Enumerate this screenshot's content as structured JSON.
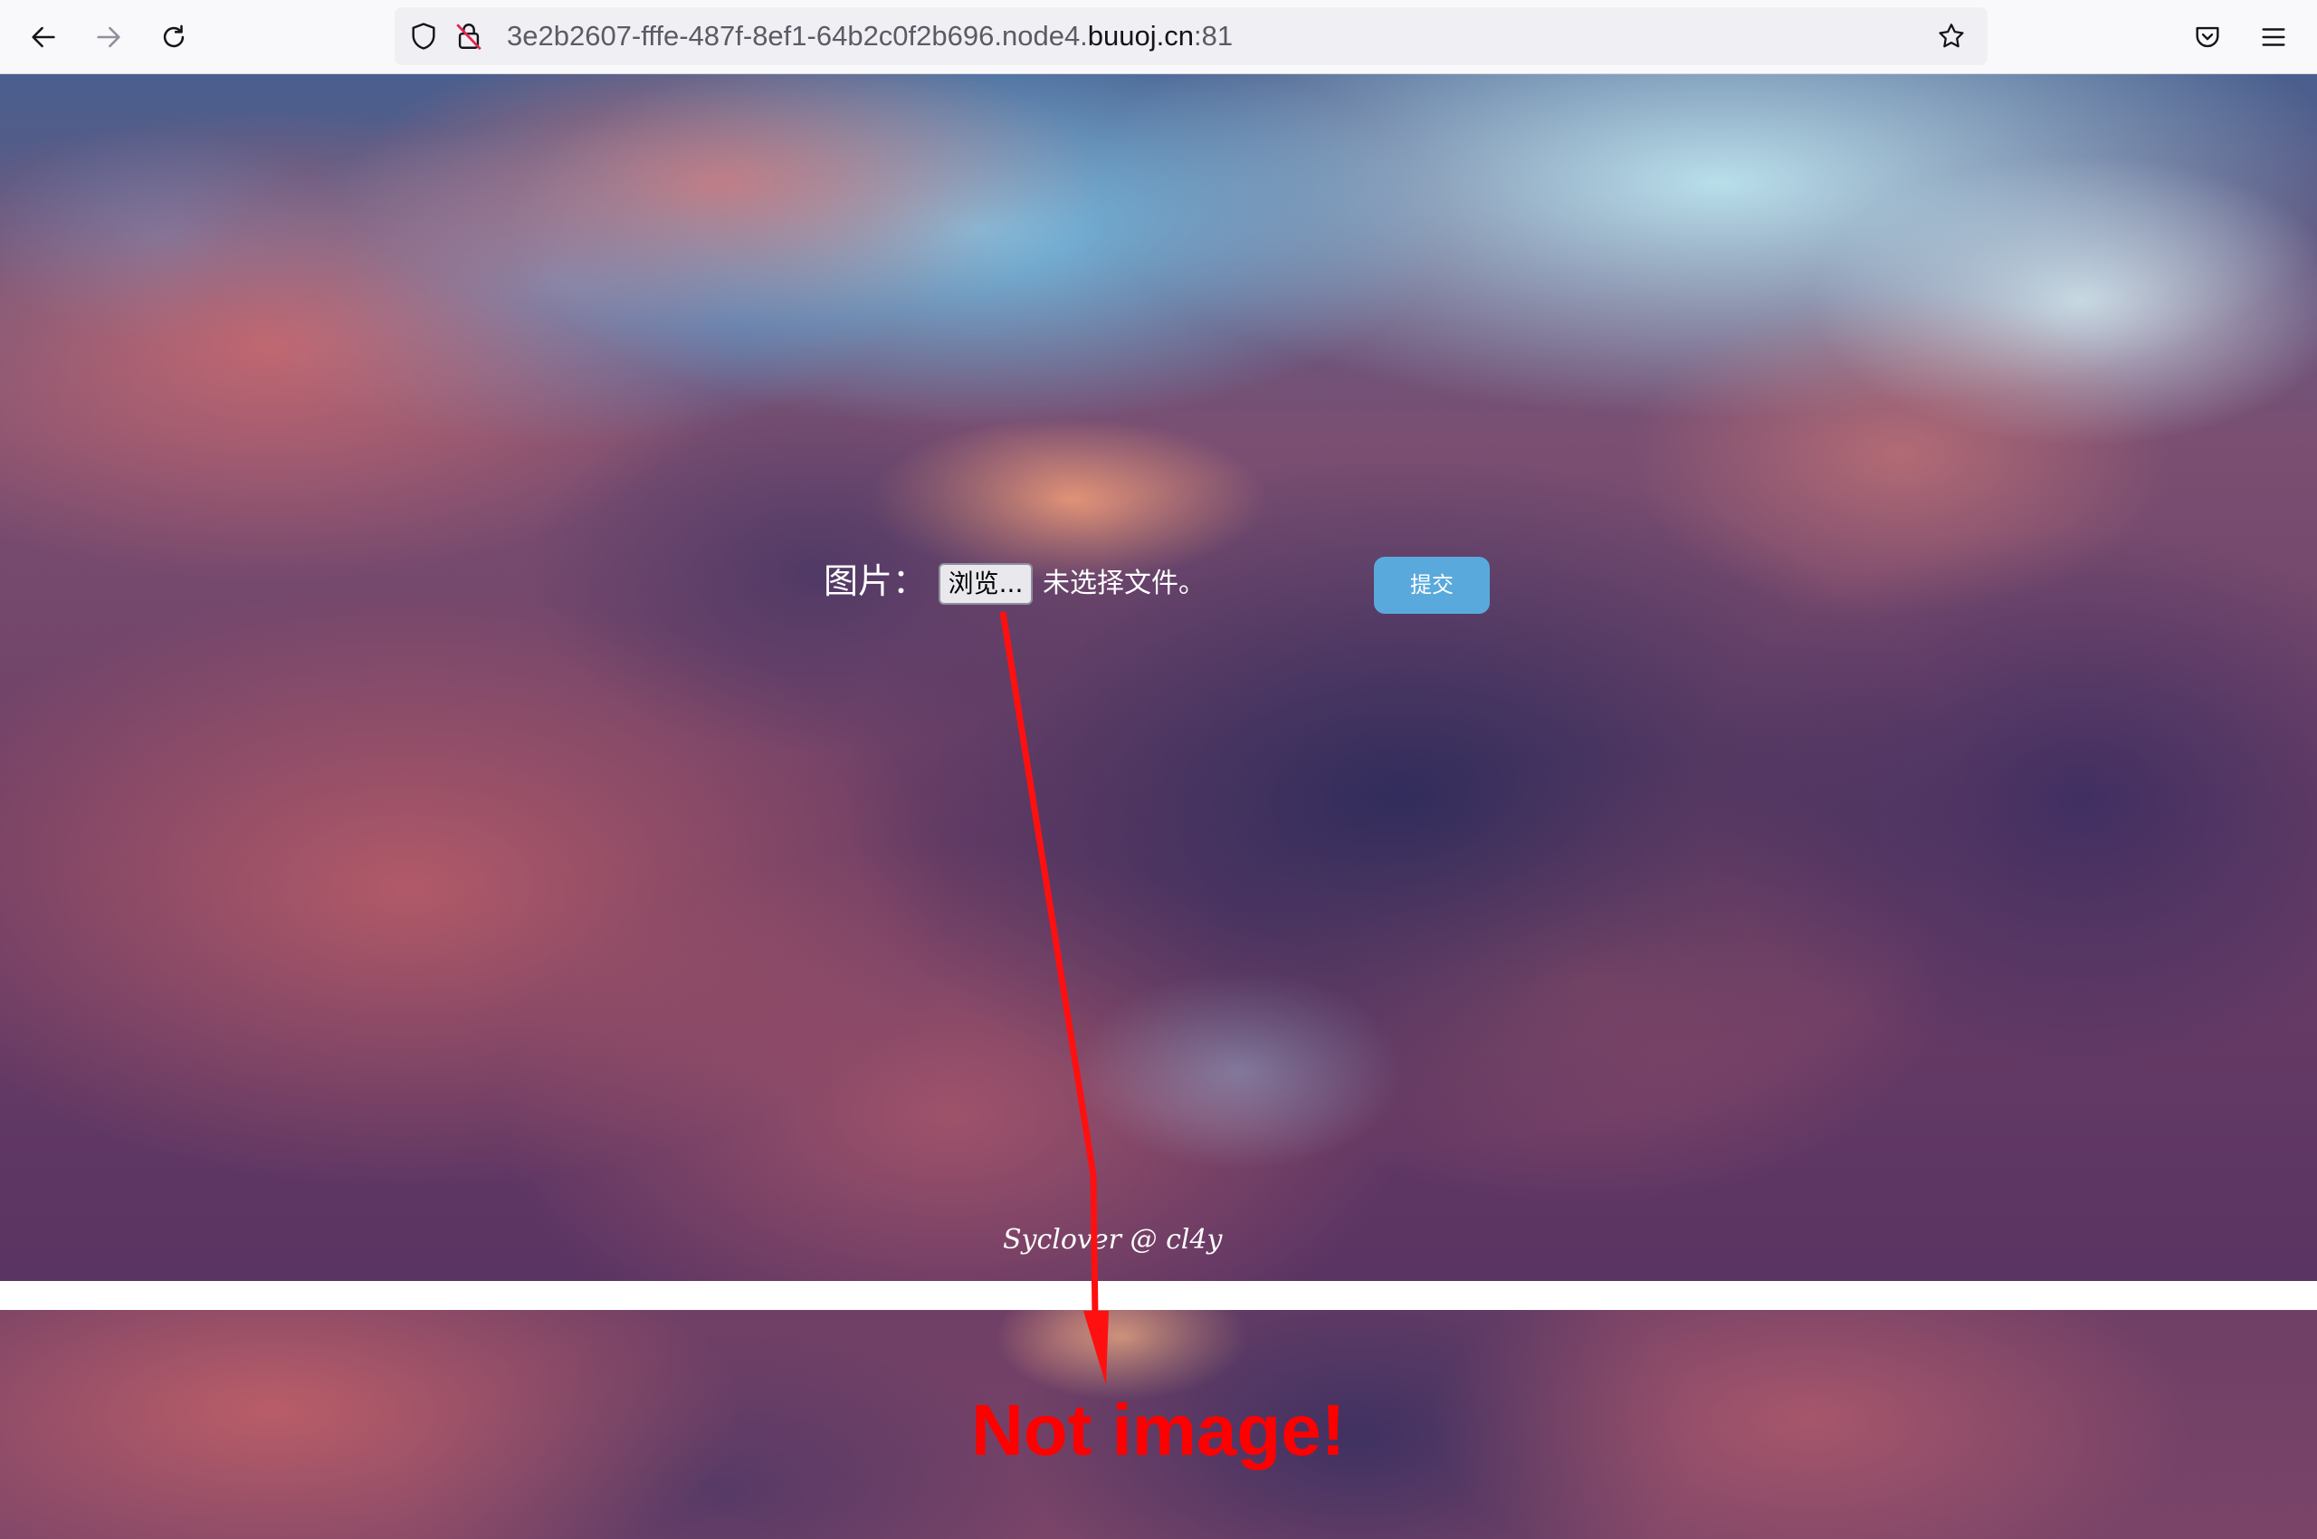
{
  "browser": {
    "url_prefix": "3e2b2607-fffe-487f-8ef1-64b2c0f2b696.node4.",
    "url_domain": "buuoj.cn",
    "url_port": ":81",
    "icons": {
      "back": "back-arrow-icon",
      "forward": "forward-arrow-icon",
      "reload": "reload-icon",
      "tracking": "shield-icon",
      "insecure": "insecure-lock-icon",
      "bookmark": "star-icon",
      "pocket": "pocket-icon",
      "menu": "hamburger-menu-icon"
    }
  },
  "upload_form": {
    "label": "图片：",
    "browse_button": "浏览...",
    "file_status": "未选择文件。",
    "submit_button": "提交"
  },
  "footer": {
    "credit": "Syclover @ cl4y"
  },
  "result": {
    "message": "Not image!"
  },
  "colors": {
    "submit_button": "#5aa9dc",
    "result_text": "#ff0000",
    "annotation_arrow": "#ff0000"
  }
}
